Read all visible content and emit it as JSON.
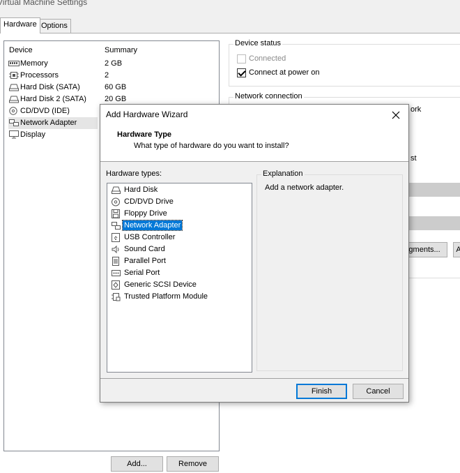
{
  "window": {
    "title": "Virtual Machine Settings"
  },
  "tabs": [
    {
      "label": "Hardware"
    },
    {
      "label": "Options"
    }
  ],
  "device_list": {
    "headers": {
      "device": "Device",
      "summary": "Summary"
    },
    "items": [
      {
        "label": "Memory",
        "summary": "2 GB",
        "icon": "memory-icon"
      },
      {
        "label": "Processors",
        "summary": "2",
        "icon": "processor-icon"
      },
      {
        "label": "Hard Disk (SATA)",
        "summary": "60 GB",
        "icon": "hard-disk-icon"
      },
      {
        "label": "Hard Disk 2 (SATA)",
        "summary": "20 GB",
        "icon": "hard-disk-icon"
      },
      {
        "label": "CD/DVD (IDE)",
        "summary": "",
        "icon": "cd-dvd-icon"
      },
      {
        "label": "Network Adapter",
        "summary": "",
        "icon": "network-adapter-icon",
        "selected": true
      },
      {
        "label": "Display",
        "summary": "",
        "icon": "display-icon"
      }
    ]
  },
  "buttons": {
    "add": "Add...",
    "remove": "Remove"
  },
  "device_status": {
    "title": "Device status",
    "connected": {
      "label": "Connected",
      "checked": false,
      "disabled": true
    },
    "connect_at_power_on": {
      "label": "Connect at power on",
      "checked": true
    }
  },
  "network_connection": {
    "title": "Network connection",
    "partial_1": "ork",
    "partial_2": "st",
    "segments_button": "egments...",
    "partial_button": "A"
  },
  "wizard": {
    "title": "Add Hardware Wizard",
    "header_title": "Hardware Type",
    "header_subtitle": "What type of hardware do you want to install?",
    "types_label": "Hardware types:",
    "types": [
      {
        "label": "Hard Disk",
        "icon": "hard-disk-icon"
      },
      {
        "label": "CD/DVD Drive",
        "icon": "cd-dvd-icon"
      },
      {
        "label": "Floppy Drive",
        "icon": "floppy-icon"
      },
      {
        "label": "Network Adapter",
        "icon": "network-adapter-icon",
        "selected": true
      },
      {
        "label": "USB Controller",
        "icon": "usb-icon"
      },
      {
        "label": "Sound Card",
        "icon": "sound-icon"
      },
      {
        "label": "Parallel Port",
        "icon": "parallel-port-icon"
      },
      {
        "label": "Serial Port",
        "icon": "serial-port-icon"
      },
      {
        "label": "Generic SCSI Device",
        "icon": "scsi-icon"
      },
      {
        "label": "Trusted Platform Module",
        "icon": "tpm-icon"
      }
    ],
    "explanation_title": "Explanation",
    "explanation_text": "Add a network adapter.",
    "finish": "Finish",
    "cancel": "Cancel"
  },
  "colors": {
    "selection": "#0078d7",
    "dialog_bg": "#f0f0f0",
    "border": "#828790"
  }
}
